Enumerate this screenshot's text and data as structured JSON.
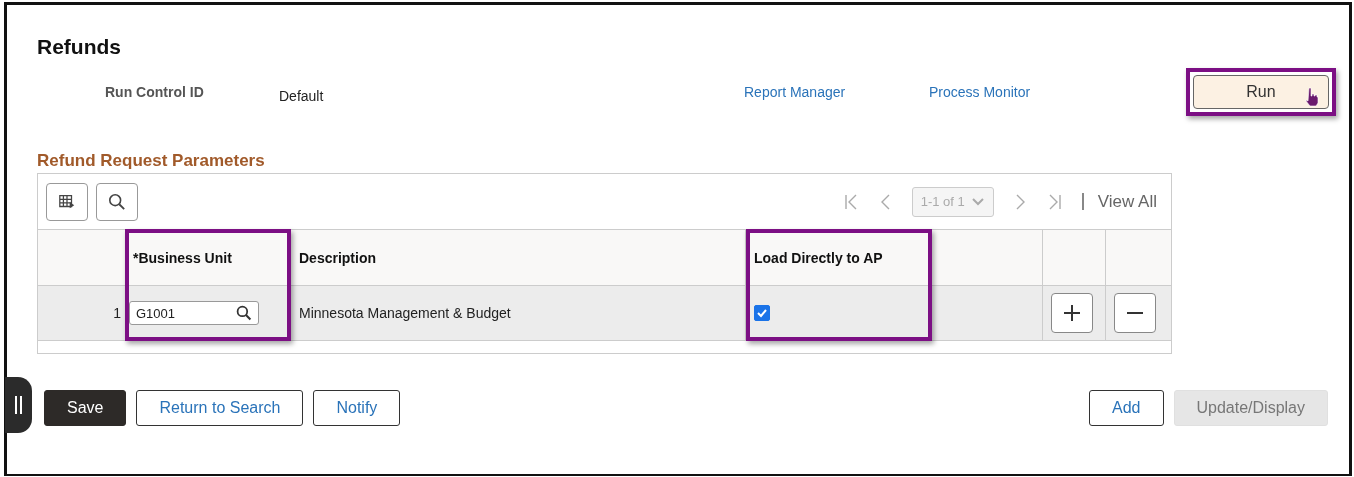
{
  "page": {
    "title": "Refunds"
  },
  "run_control": {
    "label": "Run Control ID",
    "value": "Default"
  },
  "links": [
    "Report Manager",
    "Process Monitor"
  ],
  "run_button": {
    "label": "Run",
    "highlighted": true
  },
  "section_title": "Refund Request Parameters",
  "grid": {
    "pager": {
      "range": "1-1 of 1",
      "view_all": "View All",
      "disabled": true
    },
    "columns": [
      {
        "label": "*Business Unit",
        "highlighted": true
      },
      {
        "label": "Description",
        "highlighted": false
      },
      {
        "label": "Load Directly to AP",
        "highlighted": true
      }
    ],
    "rows": [
      {
        "number": "1",
        "business_unit": "G1001",
        "description": "Minnesota Management & Budget",
        "load_directly": true
      }
    ]
  },
  "left_buttons": [
    {
      "label": "Save",
      "kind": "primary"
    },
    {
      "label": "Return to Search",
      "kind": "secondary"
    },
    {
      "label": "Notify",
      "kind": "secondary"
    }
  ],
  "right_buttons": [
    {
      "label": "Add",
      "kind": "secondary"
    },
    {
      "label": "Update/Display",
      "kind": "disabled"
    }
  ]
}
